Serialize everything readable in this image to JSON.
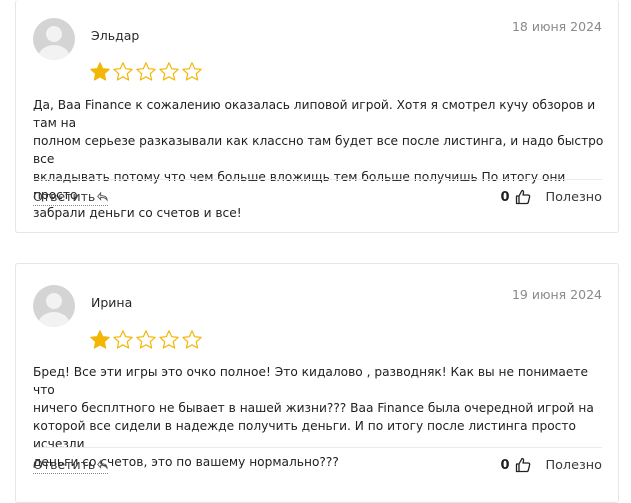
{
  "reviews": [
    {
      "author": "Эльдар",
      "date": "18 июня 2024",
      "rating": 1,
      "max_rating": 5,
      "text_lines": [
        "Да, Baa Finance к сожалению оказалась липовой игрой. Хотя я смотрел кучу обзоров и там на",
        "полном серьезе разказывали как классно там будет все после листинга, и надо быстро все",
        "вкладывать потому что чем больше вложищь тем больше получишь По итогу они просто",
        "забрали деньги со счетов и все!"
      ],
      "reply_label": "Ответить",
      "likes": "0",
      "useful_label": "Полезно"
    },
    {
      "author": "Ирина",
      "date": "19 июня 2024",
      "rating": 1,
      "max_rating": 5,
      "text_lines": [
        "Бред! Все эти игры это очко полное! Это кидалово , разводняк! Как вы не понимаете что",
        "ничего бесплтного не бывает в нашей жизни??? Baa Finance была очередной игрой на",
        "которой все сидели в надежде получить деньги. И по итогу после листинга просто исчезли",
        "деньги со счетов, это по вашему нормально???"
      ],
      "reply_label": "Ответить",
      "likes": "0",
      "useful_label": "Полезно"
    }
  ],
  "colors": {
    "star_fill": "#f2b705",
    "star_outline": "#f2b705"
  },
  "icons": {
    "star": "star-icon",
    "reply": "reply-arrow-icon",
    "like": "thumbs-up-icon"
  }
}
